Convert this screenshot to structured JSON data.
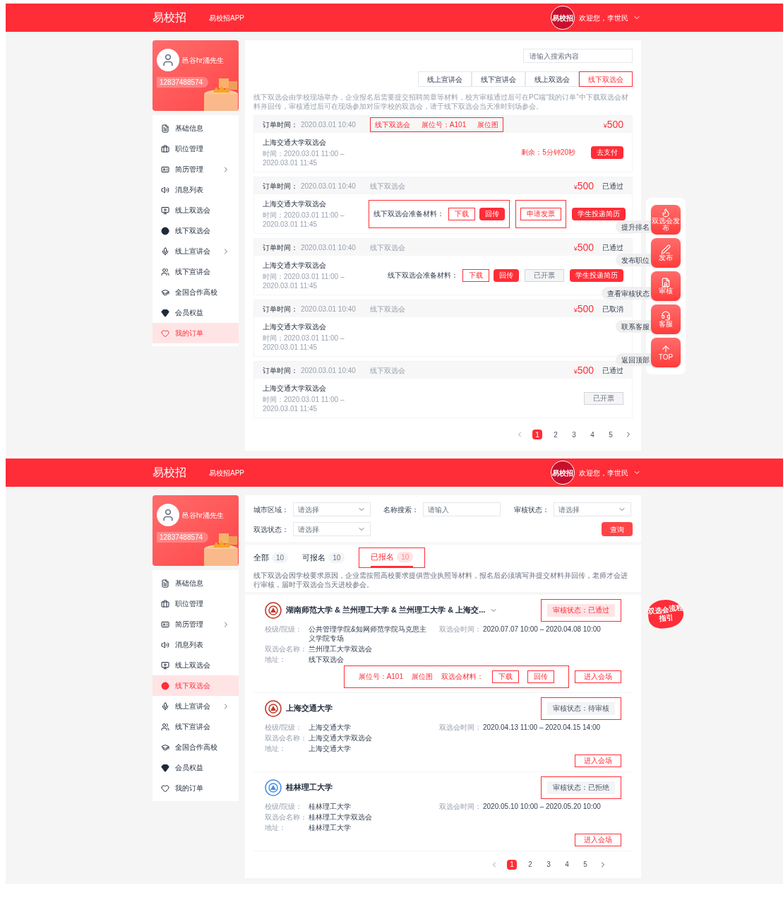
{
  "screens": [
    {
      "kind": "orders",
      "header": {
        "logo": "易校招",
        "app_link": "易校招APP",
        "badge_text": "易校招",
        "greeting": "欢迎您，李世民"
      },
      "profile": {
        "name": "邑谷hr涌先生",
        "phone": "12837488574"
      },
      "sidebar": {
        "items": [
          {
            "label": "基础信息",
            "expandable": false,
            "selected": false
          },
          {
            "label": "职位管理",
            "expandable": false,
            "selected": false
          },
          {
            "label": "简历管理",
            "expandable": true,
            "selected": false
          },
          {
            "label": "消息列表",
            "expandable": false,
            "selected": false
          },
          {
            "label": "线上双选会",
            "expandable": false,
            "selected": false
          },
          {
            "label": "线下双选会",
            "expandable": false,
            "selected": false
          },
          {
            "label": "线上宣讲会",
            "expandable": true,
            "selected": false
          },
          {
            "label": "线下宣讲会",
            "expandable": false,
            "selected": false
          },
          {
            "label": "全国合作高校",
            "expandable": false,
            "selected": false
          },
          {
            "label": "会员权益",
            "expandable": false,
            "selected": false
          },
          {
            "label": "我的订单",
            "expandable": false,
            "selected": true
          }
        ]
      },
      "search": {
        "placeholder": "请输入搜索内容"
      },
      "tabs": [
        {
          "label": "线上宣讲会",
          "selected": false
        },
        {
          "label": "线下宣讲会",
          "selected": false
        },
        {
          "label": "线上双选会",
          "selected": false
        },
        {
          "label": "线下双选会",
          "selected": true
        }
      ],
      "notice": "线下双选会由学校现场举办，企业报名后需要提交招聘简章等材料，校方审核通过后可在PC端“我的订单”中下载双选会材料并回传，审核通过后可在现场参加对应学校的双选会，请于线下双选会当天准时到场参会。",
      "orders": [
        {
          "time_label": "订单时间：",
          "time": "2020.03.01 10:40",
          "tags_highlighted": true,
          "tags": [
            {
              "text": "线下双选会",
              "kind": "link"
            },
            {
              "text": "展位号：A101",
              "kind": "link"
            },
            {
              "text": "展位图",
              "kind": "link"
            }
          ],
          "price_symbol": "¥",
          "price": "500",
          "title": "上海交通大学双选会",
          "period": "时间：2020.03.01 11:00 – 2020.03.01 11:45",
          "action_groups": [
            {
              "highlighted": false,
              "items": [
                {
                  "kind": "countdown",
                  "text": "剩余：5分钟20秒"
                },
                {
                  "kind": "solid",
                  "text": "去支付"
                }
              ]
            }
          ]
        },
        {
          "time_label": "订单时间：",
          "time": "2020.03.01 10:40",
          "tags_highlighted": false,
          "tags": [
            {
              "text": "线下双选会",
              "kind": "plain"
            }
          ],
          "price_symbol": "¥",
          "price": "500",
          "status": "已通过",
          "title": "上海交通大学双选会",
          "period": "时间：2020.03.01 11:00 – 2020.03.01 11:45",
          "action_groups": [
            {
              "highlighted": true,
              "items": [
                {
                  "kind": "text",
                  "text": "线下双选会准备材料："
                },
                {
                  "kind": "outline",
                  "text": "下载"
                },
                {
                  "kind": "solid",
                  "text": "回传"
                }
              ]
            },
            {
              "highlighted": true,
              "items": [
                {
                  "kind": "outline",
                  "text": "申请发票"
                }
              ]
            },
            {
              "highlighted": false,
              "items": [
                {
                  "kind": "solid",
                  "text": "学生投递简历"
                }
              ]
            }
          ]
        },
        {
          "time_label": "订单时间：",
          "time": "2020.03.01 10:40",
          "tags_highlighted": false,
          "tags": [
            {
              "text": "线下双选会",
              "kind": "plain"
            }
          ],
          "price_symbol": "¥",
          "price": "500",
          "status": "已通过",
          "title": "上海交通大学双选会",
          "period": "时间：2020.03.01 11:00 – 2020.03.01 11:45",
          "action_groups": [
            {
              "highlighted": false,
              "items": [
                {
                  "kind": "text",
                  "text": "线下双选会准备材料："
                },
                {
                  "kind": "outline",
                  "text": "下载"
                },
                {
                  "kind": "solid",
                  "text": "回传"
                }
              ]
            },
            {
              "highlighted": false,
              "items": [
                {
                  "kind": "disabled",
                  "text": "已开票"
                }
              ]
            },
            {
              "highlighted": false,
              "items": [
                {
                  "kind": "solid",
                  "text": "学生投递简历"
                }
              ]
            }
          ]
        },
        {
          "time_label": "订单时间：",
          "time": "2020.03.01 10:40",
          "tags_highlighted": false,
          "tags": [
            {
              "text": "线下双选会",
              "kind": "plain"
            }
          ],
          "price_symbol": "¥",
          "price": "500",
          "status": "已取消",
          "title": "上海交通大学双选会",
          "period": "时间：2020.03.01 11:00 – 2020.03.01 11:45"
        },
        {
          "time_label": "订单时间：",
          "time": "2020.03.01 10:40",
          "tags_highlighted": false,
          "tags": [
            {
              "text": "线下双选会",
              "kind": "plain"
            }
          ],
          "price_symbol": "¥",
          "price": "500",
          "status": "已通过",
          "title": "上海交通大学双选会",
          "period": "时间：2020.03.01 11:00 – 2020.03.01 11:45",
          "action_groups": [
            {
              "highlighted": false,
              "items": [
                {
                  "kind": "disabled",
                  "text": "已开票"
                }
              ]
            }
          ]
        }
      ],
      "pagination": [
        {
          "label": "1",
          "selected": true
        },
        {
          "label": "2",
          "selected": false
        },
        {
          "label": "3",
          "selected": false
        },
        {
          "label": "4",
          "selected": false
        },
        {
          "label": "5",
          "selected": false
        }
      ],
      "float_tools": [
        {
          "label": "双选会发布",
          "tooltip": "提升排名"
        },
        {
          "label": "发布",
          "tooltip": "发布职位"
        },
        {
          "label": "审核",
          "tooltip": "查看审核状态"
        },
        {
          "label": "客服",
          "tooltip": "联系客服"
        },
        {
          "label": "TOP",
          "tooltip": "返回顶部"
        }
      ]
    },
    {
      "kind": "fairs",
      "header": {
        "logo": "易校招",
        "app_link": "易校招APP",
        "badge_text": "易校招",
        "greeting": "欢迎您，李世民"
      },
      "profile": {
        "name": "邑谷hr涌先生",
        "phone": "12837488574"
      },
      "sidebar": {
        "items": [
          {
            "label": "基础信息",
            "expandable": false,
            "selected": false
          },
          {
            "label": "职位管理",
            "expandable": false,
            "selected": false
          },
          {
            "label": "简历管理",
            "expandable": true,
            "selected": false
          },
          {
            "label": "消息列表",
            "expandable": false,
            "selected": false
          },
          {
            "label": "线上双选会",
            "expandable": false,
            "selected": false
          },
          {
            "label": "线下双选会",
            "expandable": false,
            "selected": true
          },
          {
            "label": "线上宣讲会",
            "expandable": true,
            "selected": false
          },
          {
            "label": "线下宣讲会",
            "expandable": false,
            "selected": false
          },
          {
            "label": "全国合作高校",
            "expandable": false,
            "selected": false
          },
          {
            "label": "会员权益",
            "expandable": false,
            "selected": false
          },
          {
            "label": "我的订单",
            "expandable": false,
            "selected": false
          }
        ]
      },
      "filters": [
        {
          "label": "城市区域：",
          "placeholder": "请选择",
          "kind": "select"
        },
        {
          "label": "名称搜索：",
          "placeholder": "请输入",
          "kind": "input"
        },
        {
          "label": "审核状态：",
          "placeholder": "请选择",
          "kind": "select"
        },
        {
          "label": "双选状态：",
          "placeholder": "请选择",
          "kind": "select"
        }
      ],
      "query_button": "查询",
      "tabs": [
        {
          "label": "全部",
          "count": "10",
          "selected": false,
          "highlighted": false
        },
        {
          "label": "可报名",
          "count": "10",
          "selected": false,
          "highlighted": false
        },
        {
          "label": "已报名",
          "count": "10",
          "selected": true,
          "highlighted": true
        }
      ],
      "notice": "线下双选会因学校要求原因，企业需按照高校要求提供营业执照等材料，报名后必须填写并提交材料并回传，老师才会进行审核，届时于双选会当天进校参会。",
      "fairs": [
        {
          "color": "#c0392b",
          "title": "湖南师范大学 & 兰州理工大学 & 兰州理工大学 & 上海交...",
          "expandable": true,
          "status": "审核状态：已通过",
          "approved": true,
          "status_highlighted": true,
          "fields": [
            {
              "label": "校级/院级：",
              "value": "公共管理学院&知网师范学院马克思主义学院专场"
            },
            {
              "label": "双选会名称：",
              "value": "兰州理工大学双选会"
            },
            {
              "label": "地址：",
              "value": "线下双选会"
            }
          ],
          "time_label": "双选会时间：",
          "time": "2020.07.07 10:00 – 2020.04.08 10:00",
          "actions_highlighted": true,
          "actions": [
            {
              "kind": "red_text",
              "text": "展位号：A101"
            },
            {
              "kind": "red_text",
              "text": "展位图"
            },
            {
              "kind": "red_text",
              "text": "双选会材料："
            },
            {
              "kind": "outline",
              "text": "下载"
            },
            {
              "kind": "outline",
              "text": "回传"
            }
          ],
          "enter_button": "进入会场"
        },
        {
          "color": "#c0392b",
          "title": "上海交通大学",
          "expandable": false,
          "status": "审核状态：待审核",
          "approved": false,
          "status_highlighted": true,
          "fields": [
            {
              "label": "校级/院级：",
              "value": "上海交通大学"
            },
            {
              "label": "双选会名称：",
              "value": "上海交通大学双选会"
            },
            {
              "label": "地址：",
              "value": "上海交通大学"
            }
          ],
          "time_label": "双选会时间：",
          "time": "2020.04.13 11:00 – 2020.04.15 14:00",
          "enter_button": "进入会场"
        },
        {
          "color": "#4a90e2",
          "title": "桂林理工大学",
          "expandable": false,
          "status": "审核状态：已拒绝",
          "approved": false,
          "status_highlighted": true,
          "fields": [
            {
              "label": "校级/院级：",
              "value": "桂林理工大学"
            },
            {
              "label": "双选会名称：",
              "value": "桂林理工大学双选会"
            },
            {
              "label": "地址：",
              "value": "桂林理工大学"
            }
          ],
          "time_label": "双选会时间：",
          "time": "2020.05.10 10:00 – 2020.05.20 10:00",
          "enter_button": "进入会场"
        }
      ],
      "pagination": [
        {
          "label": "1",
          "selected": true
        },
        {
          "label": "2",
          "selected": false
        },
        {
          "label": "3",
          "selected": false
        },
        {
          "label": "4",
          "selected": false
        },
        {
          "label": "5",
          "selected": false
        }
      ],
      "guide_badge": "双选会流程指引"
    }
  ]
}
